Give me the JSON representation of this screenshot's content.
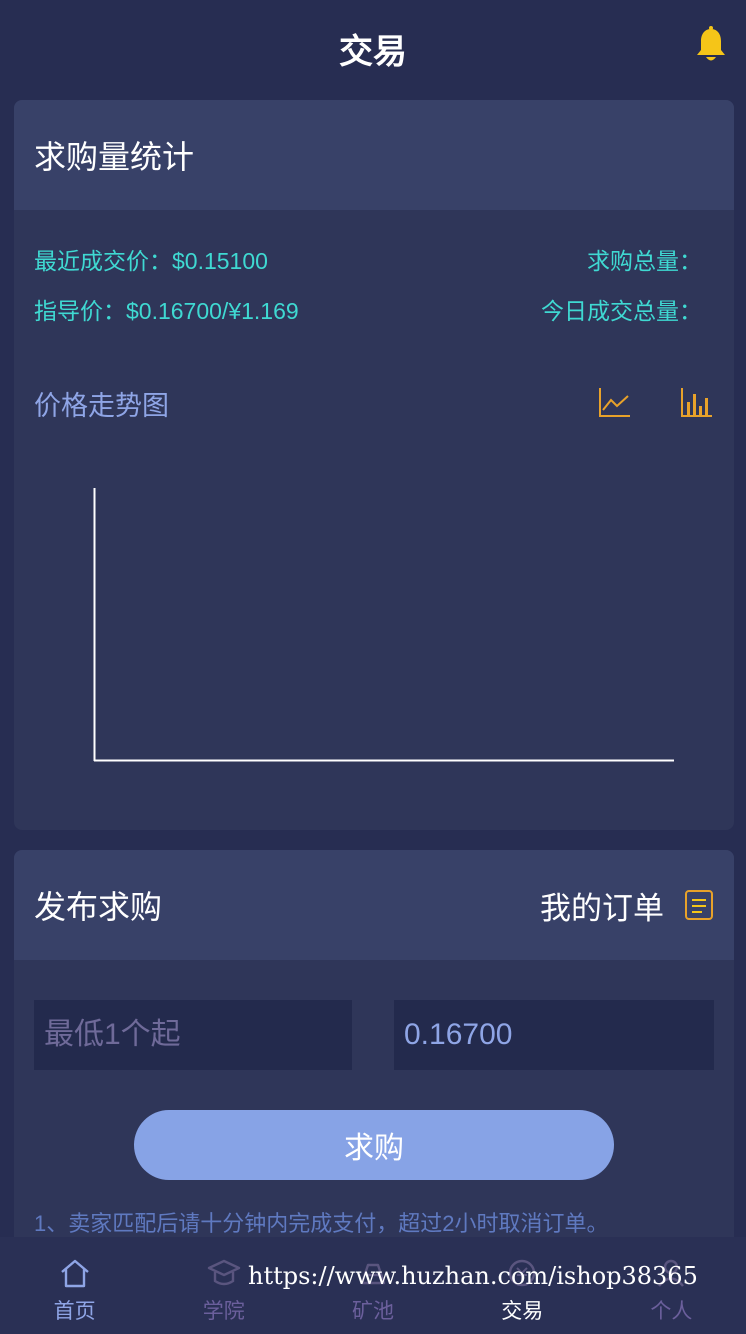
{
  "header": {
    "title": "交易",
    "bell_icon": "bell-icon"
  },
  "stats_card": {
    "title": "求购量统计",
    "latest_price_label": "最近成交价：",
    "latest_price_value": "$0.15100",
    "total_demand_label": "求购总量：",
    "guide_price_label": "指导价：",
    "guide_price_value": "$0.16700/¥1.169",
    "today_volume_label": "今日成交总量：",
    "trend_title": "价格走势图",
    "line_chart_icon": "line-chart-icon",
    "bar_chart_icon": "bar-chart-icon"
  },
  "chart_data": {
    "type": "line",
    "title": "",
    "xlabel": "",
    "ylabel": "",
    "x": [],
    "series": []
  },
  "order_card": {
    "title": "发布求购",
    "my_orders_label": "我的订单",
    "quantity_placeholder": "最低1个起",
    "price_value": "0.16700",
    "buy_button": "求购",
    "notice": "1、卖家匹配后请十分钟内完成支付，超过2小时取消订单。"
  },
  "tabbar": {
    "items": [
      {
        "label": "首页",
        "icon": "home-icon"
      },
      {
        "label": "学院",
        "icon": "graduation-cap-icon"
      },
      {
        "label": "矿池",
        "icon": "mine-icon"
      },
      {
        "label": "交易",
        "icon": "trade-icon"
      },
      {
        "label": "个人",
        "icon": "user-icon"
      }
    ]
  },
  "watermark": "https://www.huzhan.com/ishop38365",
  "colors": {
    "background": "#272d52",
    "card": "#2f3659",
    "card_header": "#384168",
    "accent_cyan": "#3fd9d2",
    "button": "#87a3e6",
    "bell": "#f5c518",
    "icon_orange": "#e8a22a"
  }
}
